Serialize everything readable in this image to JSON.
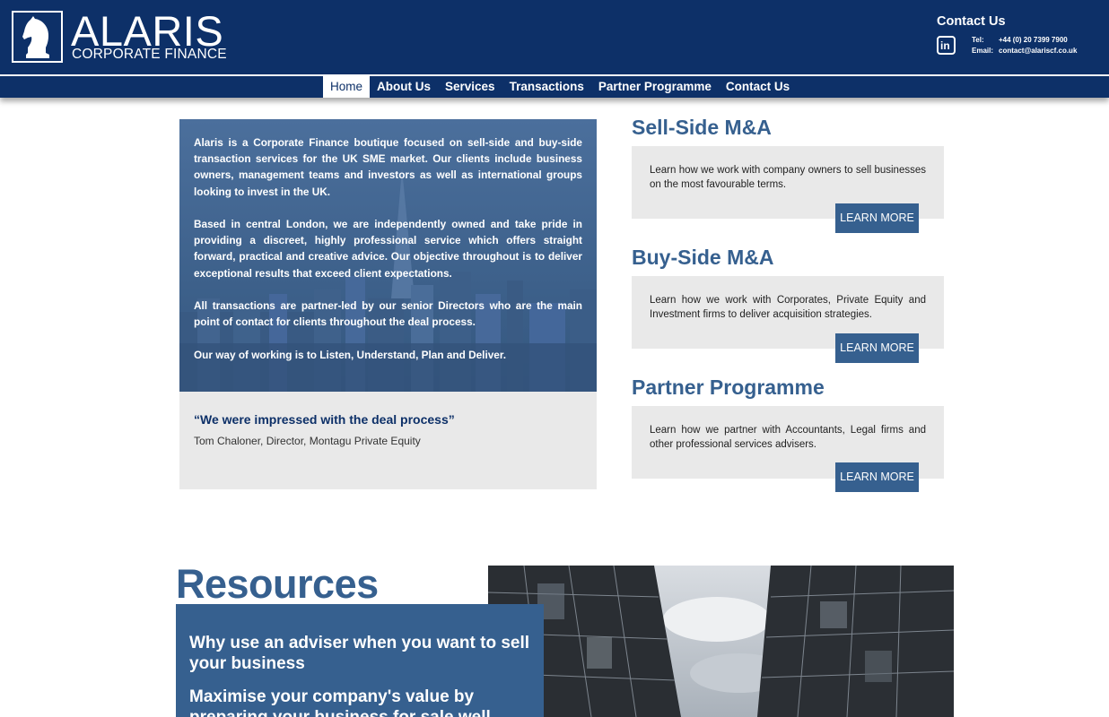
{
  "brand": {
    "name": "ALARIS",
    "subtitle": "CORPORATE FINANCE"
  },
  "contact": {
    "heading": "Contact Us",
    "linkedin_icon": "linkedin-icon",
    "tel_label": "Tel:",
    "tel_value": "+44 (0) 20 7399 7900",
    "email_label": "Email:",
    "email_value": "contact@alariscf.co.uk"
  },
  "nav": {
    "items": [
      {
        "label": "Home",
        "active": true
      },
      {
        "label": "About Us"
      },
      {
        "label": "Services"
      },
      {
        "label": "Transactions"
      },
      {
        "label": "Partner Programme"
      },
      {
        "label": "Contact Us"
      }
    ]
  },
  "intro": {
    "paragraphs": [
      "Alaris is a Corporate Finance boutique focused on sell-side and buy-side transaction services for the UK SME market. Our clients include business owners, management teams and investors as well as international groups looking to invest in the UK.",
      "Based in central London, we are independently owned and take pride in providing a discreet, highly professional service which offers straight forward, practical and creative advice. Our objective throughout is to deliver exceptional results that exceed client expectations.",
      "All transactions are partner-led by our senior Directors who are the main point of contact for clients throughout the deal process.",
      "Our way of working is to Listen, Understand, Plan and Deliver."
    ]
  },
  "testimonial": {
    "quote": "“We were impressed with the deal process”",
    "author": "Tom Chaloner, Director, Montagu Private Equity"
  },
  "services": [
    {
      "title": "Sell-Side M&A",
      "description": "Learn how we work with company owners to sell businesses on the most favourable terms.",
      "button": "LEARN MORE"
    },
    {
      "title": "Buy-Side M&A",
      "description": "Learn how we work with Corporates, Private Equity and Investment firms to deliver acquisition strategies.",
      "button": "LEARN MORE"
    },
    {
      "title": "Partner Programme",
      "description": "Learn how we partner with Accountants, Legal firms and other professional services advisers.",
      "button": "LEARN MORE"
    }
  ],
  "resources": {
    "title": "Resources",
    "items": [
      "Why use an adviser when you want to sell your business",
      "Maximise your company's value by preparing your business for sale well"
    ]
  },
  "colors": {
    "header_bg": "#0d3068",
    "accent": "#36608f",
    "panel_bg": "#e9e9e9"
  }
}
